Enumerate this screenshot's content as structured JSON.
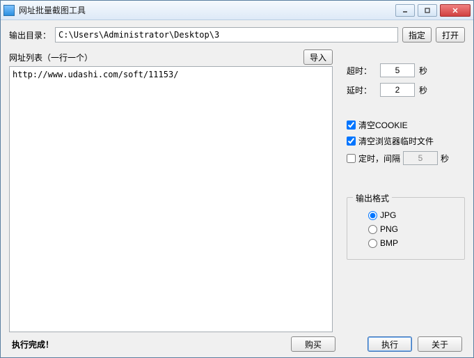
{
  "window": {
    "title": "网址批量截图工具"
  },
  "output": {
    "label": "输出目录：",
    "path": "C:\\Users\\Administrator\\Desktop\\3",
    "specify_btn": "指定",
    "open_btn": "打开"
  },
  "list": {
    "label": "网址列表（一行一个）",
    "import_btn": "导入",
    "content": "http://www.udashi.com/soft/11153/"
  },
  "params": {
    "timeout_label": "超时：",
    "timeout_value": "5",
    "delay_label": "延时：",
    "delay_value": "2",
    "unit": "秒"
  },
  "options": {
    "clear_cookie": {
      "label": "清空COOKIE",
      "checked": true
    },
    "clear_temp": {
      "label": "清空浏览器临时文件",
      "checked": true
    },
    "timer": {
      "label": "定时，间隔",
      "checked": false,
      "value": "5",
      "unit": "秒"
    }
  },
  "format": {
    "legend": "输出格式",
    "options": [
      "JPG",
      "PNG",
      "BMP"
    ],
    "selected": "JPG"
  },
  "footer": {
    "status": "执行完成！",
    "buy_btn": "购买",
    "execute_btn": "执行",
    "about_btn": "关于"
  }
}
